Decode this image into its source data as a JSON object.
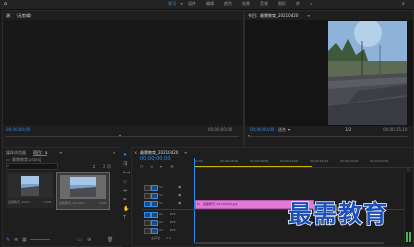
{
  "topbar": {
    "home_icon": "home-icon",
    "workspaces": [
      "学习",
      "组件",
      "编辑",
      "颜色",
      "效果",
      "音频",
      "图形",
      "库"
    ],
    "active_index": 1
  },
  "source": {
    "tab_label": "源：（无剪辑）",
    "timecode": "00;00;00;00",
    "right_timecode": "00;00;00;00"
  },
  "program": {
    "tab_label": "节目：最需教育_20210420",
    "timecode": "00;00;00;00",
    "fit_label": "适合",
    "page": "1/2",
    "right_timecode": "00;00;35;10"
  },
  "project": {
    "tabs": [
      "媒体浏览器",
      "项目：a"
    ],
    "active_tab": 1,
    "project_name": "最需教育.prproj",
    "search_placeholder": "",
    "items_count": "2 项",
    "items": [
      {
        "name": "最需教育_2021...",
        "duration": "5:08"
      },
      {
        "name": "最需教育_202104...",
        "duration": "5:08"
      }
    ]
  },
  "timeline": {
    "tab_label": "最需教育_20210420",
    "timecode": "00;00;00;00",
    "ruler": [
      "00;00",
      "00;00;04;00",
      "00;00;08;00",
      "00;00;12;00",
      "00;00;16;00",
      "00;00;20;00",
      "00;00;24;00"
    ],
    "video_tracks": [
      "V3",
      "V2",
      "V1"
    ],
    "audio_tracks": [
      "A1",
      "A2",
      "A3"
    ],
    "master_label": "主声道",
    "master_value": "0.0",
    "clip_label": "最需教育_20210420.jpg"
  },
  "watermark": "最需教育",
  "colors": {
    "accent": "#2d8ceb",
    "clip": "#e07ad6",
    "audio_bar": "#4caf50"
  }
}
